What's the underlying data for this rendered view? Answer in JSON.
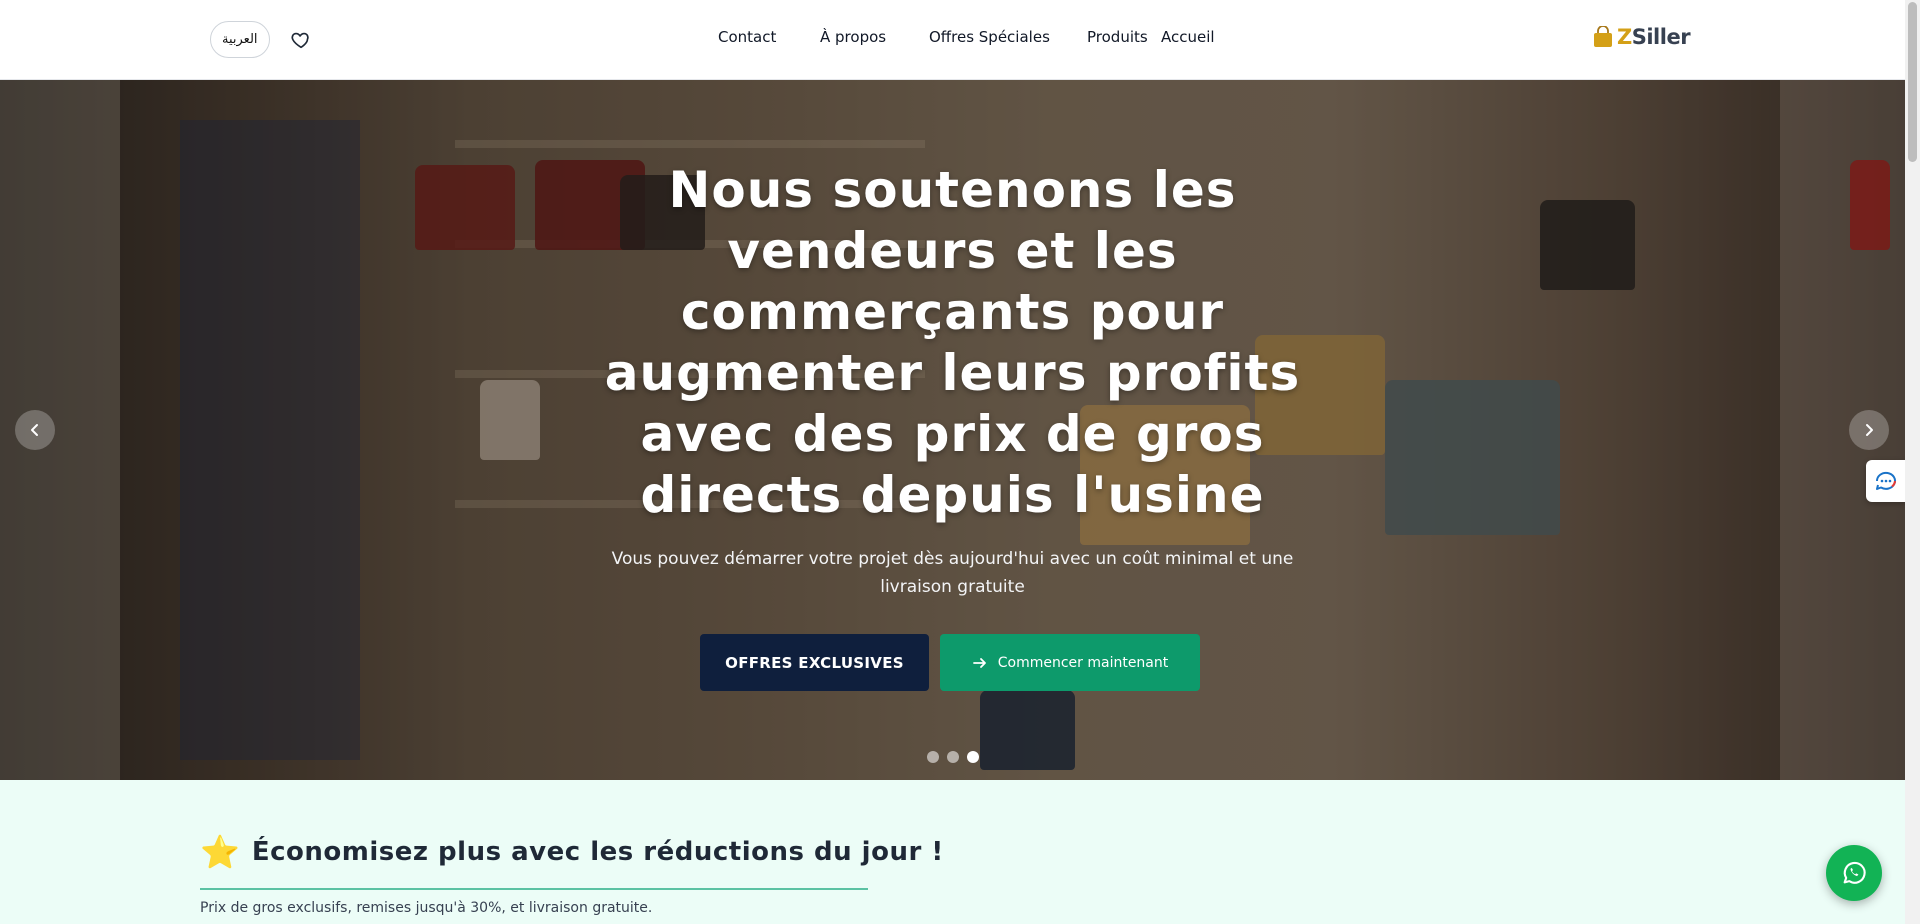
{
  "header": {
    "language_button": "العربية",
    "nav": [
      {
        "label": "Contact"
      },
      {
        "label": "À propos"
      },
      {
        "label": "Offres Spéciales"
      },
      {
        "label": "Produits"
      },
      {
        "label": "Accueil"
      }
    ],
    "logo": {
      "z": "Z",
      "rest": "Siller"
    }
  },
  "hero": {
    "title": "Nous soutenons les vendeurs et les commerçants pour augmenter leurs profits avec des prix de gros directs depuis l'usine",
    "subtitle": "Vous pouvez démarrer votre projet dès aujourd'hui avec un coût minimal et une livraison gratuite",
    "primary_button": "OFFRES EXCLUSIVES",
    "secondary_button": "Commencer maintenant",
    "slides_total": 3,
    "active_slide": 3
  },
  "deals": {
    "star": "⭐",
    "title": "Économisez plus avec les réductions du jour !",
    "subtitle": "Prix de gros exclusifs, remises jusqu'à 30%, et livraison gratuite."
  },
  "colors": {
    "primary_dark": "#0f1f3d",
    "accent_green": "#0d9a6b",
    "whatsapp": "#12b355",
    "deals_bg": "#ecfdf7"
  },
  "icons": {
    "favorites": "heart-icon",
    "prev": "chevron-left-icon",
    "next": "chevron-right-icon",
    "start": "arrow-right-icon",
    "chat": "chat-widget-icon",
    "whatsapp": "whatsapp-icon"
  }
}
